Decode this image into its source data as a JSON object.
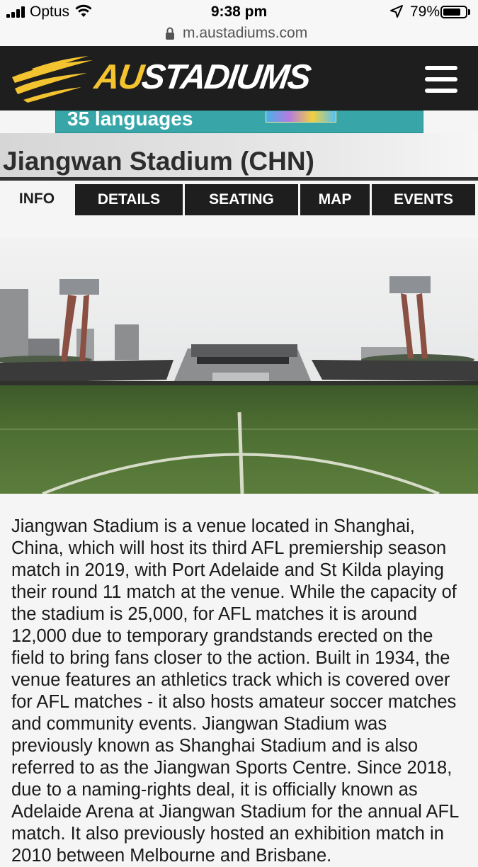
{
  "status_bar": {
    "carrier": "Optus",
    "time": "9:38 pm",
    "battery_percent": "79%",
    "battery_level": 0.79
  },
  "browser": {
    "url": "m.austadiums.com"
  },
  "header": {
    "logo_accent": "AU",
    "logo_rest": "STADIUMS",
    "menu_icon": "hamburger-menu-icon",
    "colors": {
      "background": "#1e1e1e",
      "logo_gold": "#f4c430"
    }
  },
  "ad": {
    "text": "35 languages"
  },
  "page": {
    "title": "Jiangwan Stadium (CHN)"
  },
  "tabs": [
    {
      "label": "INFO",
      "active": true
    },
    {
      "label": "DETAILS",
      "active": false
    },
    {
      "label": "SEATING",
      "active": false
    },
    {
      "label": "MAP",
      "active": false
    },
    {
      "label": "EVENTS",
      "active": false
    }
  ],
  "content": {
    "description": "Jiangwan Stadium is a venue located in Shanghai, China, which will host its third AFL premiership season match in 2019, with Port Adelaide and St Kilda playing their round 11 match at the venue. While the capacity of the stadium is 25,000, for AFL matches it is around 12,000 due to temporary grandstands erected on the field to bring fans closer to the action. Built in 1934, the venue features an athletics track which is covered over for AFL matches - it also hosts amateur soccer matches and community events. Jiangwan Stadium was previously known as Shanghai Stadium and is also referred to as the Jiangwan Sports Centre. Since 2018, due to a naming-rights deal, it is officially known as Adelaide Arena at Jiangwan Stadium for the annual AFL match. It also previously hosted an exhibition match in 2010 between Melbourne and Brisbane."
  }
}
